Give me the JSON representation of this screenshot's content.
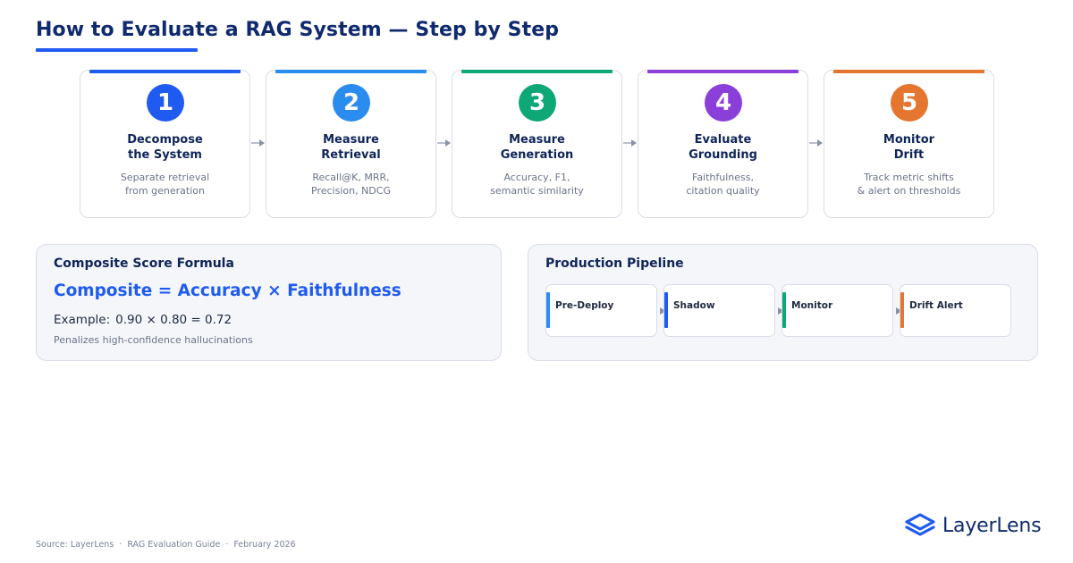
{
  "title": "How to Evaluate a RAG System — Step by Step",
  "steps": [
    {
      "number": "1",
      "title_line1": "Decompose",
      "title_line2": "the System",
      "desc_line1": "Separate retrieval",
      "desc_line2": "from generation",
      "color": "#1f5bf0"
    },
    {
      "number": "2",
      "title_line1": "Measure",
      "title_line2": "Retrieval",
      "desc_line1": "Recall@K, MRR,",
      "desc_line2": "Precision, NDCG",
      "color": "#2b8cf0"
    },
    {
      "number": "3",
      "title_line1": "Measure",
      "title_line2": "Generation",
      "desc_line1": "Accuracy, F1,",
      "desc_line2": "semantic similarity",
      "color": "#0ea776"
    },
    {
      "number": "4",
      "title_line1": "Evaluate",
      "title_line2": "Grounding",
      "desc_line1": "Faithfulness,",
      "desc_line2": "citation quality",
      "color": "#8b3fd9"
    },
    {
      "number": "5",
      "title_line1": "Monitor",
      "title_line2": "Drift",
      "desc_line1": "Track metric shifts",
      "desc_line2": "& alert on thresholds",
      "color": "#e5762f"
    }
  ],
  "composite": {
    "title": "Composite Score Formula",
    "formula": "Composite = Accuracy × Faithfulness",
    "example_label": "Example:",
    "example_value": "0.90 × 0.80 = 0.72",
    "note": "Penalizes high-confidence hallucinations"
  },
  "pipeline": {
    "title": "Production Pipeline",
    "stages": [
      {
        "label": "Pre-Deploy",
        "color": "#2b8cf0"
      },
      {
        "label": "Shadow",
        "color": "#1f5bf0"
      },
      {
        "label": "Monitor",
        "color": "#0ea776"
      },
      {
        "label": "Drift Alert",
        "color": "#e5762f"
      }
    ]
  },
  "footer": {
    "source": "Source: LayerLens",
    "guide": "RAG Evaluation Guide",
    "date": "February 2026",
    "separator": "·"
  },
  "brand": {
    "name": "LayerLens",
    "icon": "layers-logo-icon",
    "color": "#1f5bf0"
  }
}
